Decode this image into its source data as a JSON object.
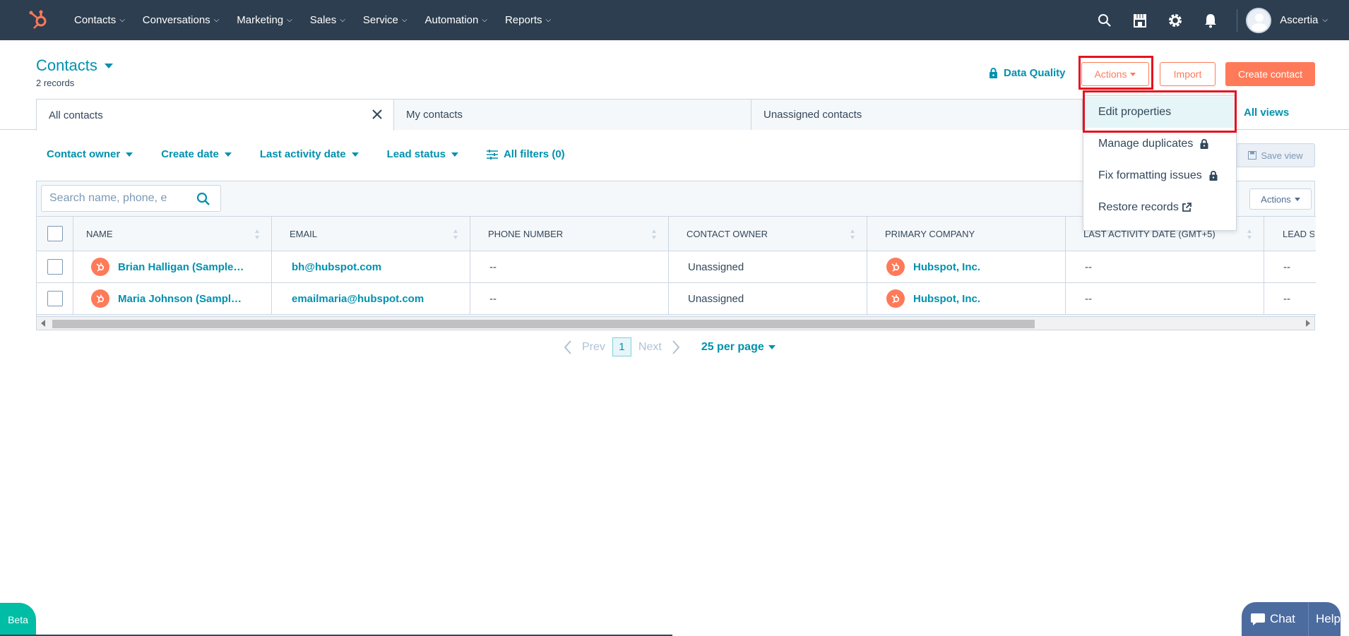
{
  "nav": {
    "items": [
      {
        "label": "Contacts"
      },
      {
        "label": "Conversations"
      },
      {
        "label": "Marketing"
      },
      {
        "label": "Sales"
      },
      {
        "label": "Service"
      },
      {
        "label": "Automation"
      },
      {
        "label": "Reports"
      }
    ],
    "user_name": "Ascertia"
  },
  "header": {
    "title": "Contacts",
    "record_count": "2 records",
    "data_quality": "Data Quality",
    "actions_label": "Actions",
    "import_label": "Import",
    "create_label": "Create contact"
  },
  "tabs": [
    {
      "label": "All contacts"
    },
    {
      "label": "My contacts"
    },
    {
      "label": "Unassigned contacts"
    }
  ],
  "all_views": "All views",
  "filters": {
    "contact_owner": "Contact owner",
    "create_date": "Create date",
    "last_activity": "Last activity date",
    "lead_status": "Lead status",
    "all_filters": "All filters (0)",
    "save_view": "Save view"
  },
  "table": {
    "search_placeholder": "Search name, phone, e",
    "actions_label": "Actions",
    "columns": [
      "NAME",
      "EMAIL",
      "PHONE NUMBER",
      "CONTACT OWNER",
      "PRIMARY COMPANY",
      "LAST ACTIVITY DATE (GMT+5)",
      "LEAD S"
    ],
    "rows": [
      {
        "name": "Brian Halligan (Sample…",
        "email": "bh@hubspot.com",
        "phone": "--",
        "owner": "Unassigned",
        "company": "Hubspot, Inc.",
        "last_activity": "--",
        "lead": "--"
      },
      {
        "name": "Maria Johnson (Sampl…",
        "email": "emailmaria@hubspot.com",
        "phone": "--",
        "owner": "Unassigned",
        "company": "Hubspot, Inc.",
        "last_activity": "--",
        "lead": "--"
      }
    ]
  },
  "pagination": {
    "prev": "Prev",
    "page": "1",
    "next": "Next",
    "per_page": "25 per page"
  },
  "dropdown": {
    "items": [
      {
        "label": "Edit properties"
      },
      {
        "label": "Manage duplicates"
      },
      {
        "label": "Fix formatting issues"
      },
      {
        "label": "Restore records"
      }
    ]
  },
  "widgets": {
    "beta": "Beta",
    "chat": "Chat",
    "help": "Help"
  },
  "colors": {
    "nav_bg": "#2d3e50",
    "accent": "#0091ae",
    "brand_orange": "#ff7a59",
    "highlight_red": "#e5131f"
  }
}
